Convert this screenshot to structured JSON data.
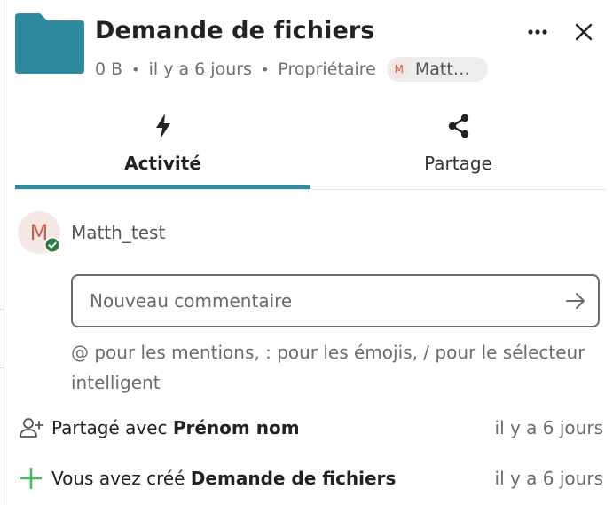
{
  "header": {
    "title": "Demande de fichiers",
    "size": "0 B",
    "modified": "il y a 6 jours",
    "role": "Propriétaire",
    "owner_initial": "M",
    "owner_name": "Matt…",
    "folder_color": "#2f8aa0"
  },
  "tabs": [
    {
      "label": "Activité",
      "icon": "flash-icon",
      "active": true
    },
    {
      "label": "Partage",
      "icon": "share-icon",
      "active": false
    }
  ],
  "current_user": {
    "initial": "M",
    "name": "Matth_test",
    "status": "online"
  },
  "comment": {
    "placeholder": "Nouveau commentaire",
    "value": "",
    "hint": "@ pour les mentions, : pour les émojis, / pour le sélecteur intelligent"
  },
  "activities": [
    {
      "icon": "user-add-icon",
      "prefix": "Partagé avec ",
      "bold": "Prénom nom",
      "time": "il y a 6 jours"
    },
    {
      "icon": "plus-icon",
      "prefix": "Vous avez créé ",
      "bold": "Demande de fichiers",
      "time": "il y a 6 jours"
    }
  ],
  "colors": {
    "accent": "#2f8aa0",
    "status_online": "#2d7b41",
    "create_green": "#46ba61"
  }
}
